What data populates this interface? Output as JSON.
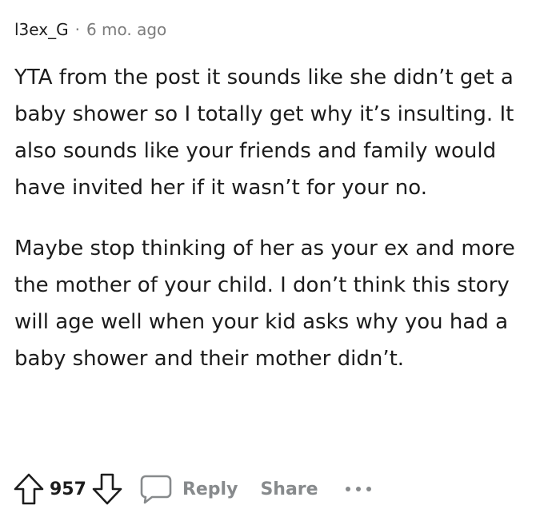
{
  "comment": {
    "author": "l3ex_G",
    "separator": "·",
    "time": "6 mo. ago",
    "paragraphs": [
      "YTA from the post it sounds like she didn’t get a baby shower so I totally get why it’s insulting. It also sounds like your friends and family would have invited her if it wasn’t for your no.",
      "Maybe stop thinking of her as your ex and more the mother of your child. I don’t think this story will age well when your kid asks why you had a baby shower and their mother didn’t."
    ]
  },
  "actions": {
    "score": "957",
    "reply_label": "Reply",
    "share_label": "Share",
    "upvote_icon": "upvote-arrow-icon",
    "downvote_icon": "downvote-arrow-icon",
    "reply_icon": "speech-bubble-icon",
    "more_icon": "ellipsis-icon"
  },
  "colors": {
    "text": "#1c1c1c",
    "muted": "#7c7c7c",
    "action": "#878a8c"
  }
}
